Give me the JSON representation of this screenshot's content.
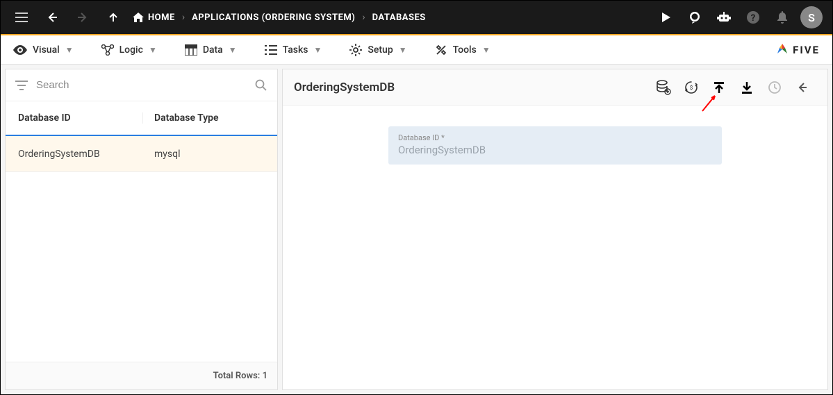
{
  "topbar": {
    "breadcrumbs": {
      "home": "HOME",
      "app": "APPLICATIONS (ORDERING SYSTEM)",
      "section": "DATABASES"
    },
    "avatar_initial": "S"
  },
  "menubar": {
    "visual": "Visual",
    "logic": "Logic",
    "data": "Data",
    "tasks": "Tasks",
    "setup": "Setup",
    "tools": "Tools",
    "brand": "FIVE"
  },
  "left": {
    "search_placeholder": "Search",
    "columns": {
      "id": "Database ID",
      "type": "Database Type"
    },
    "rows": [
      {
        "id": "OrderingSystemDB",
        "type": "mysql"
      }
    ],
    "footer_label": "Total Rows:",
    "footer_count": "1"
  },
  "detail": {
    "title": "OrderingSystemDB",
    "field_label": "Database ID *",
    "field_value": "OrderingSystemDB"
  }
}
